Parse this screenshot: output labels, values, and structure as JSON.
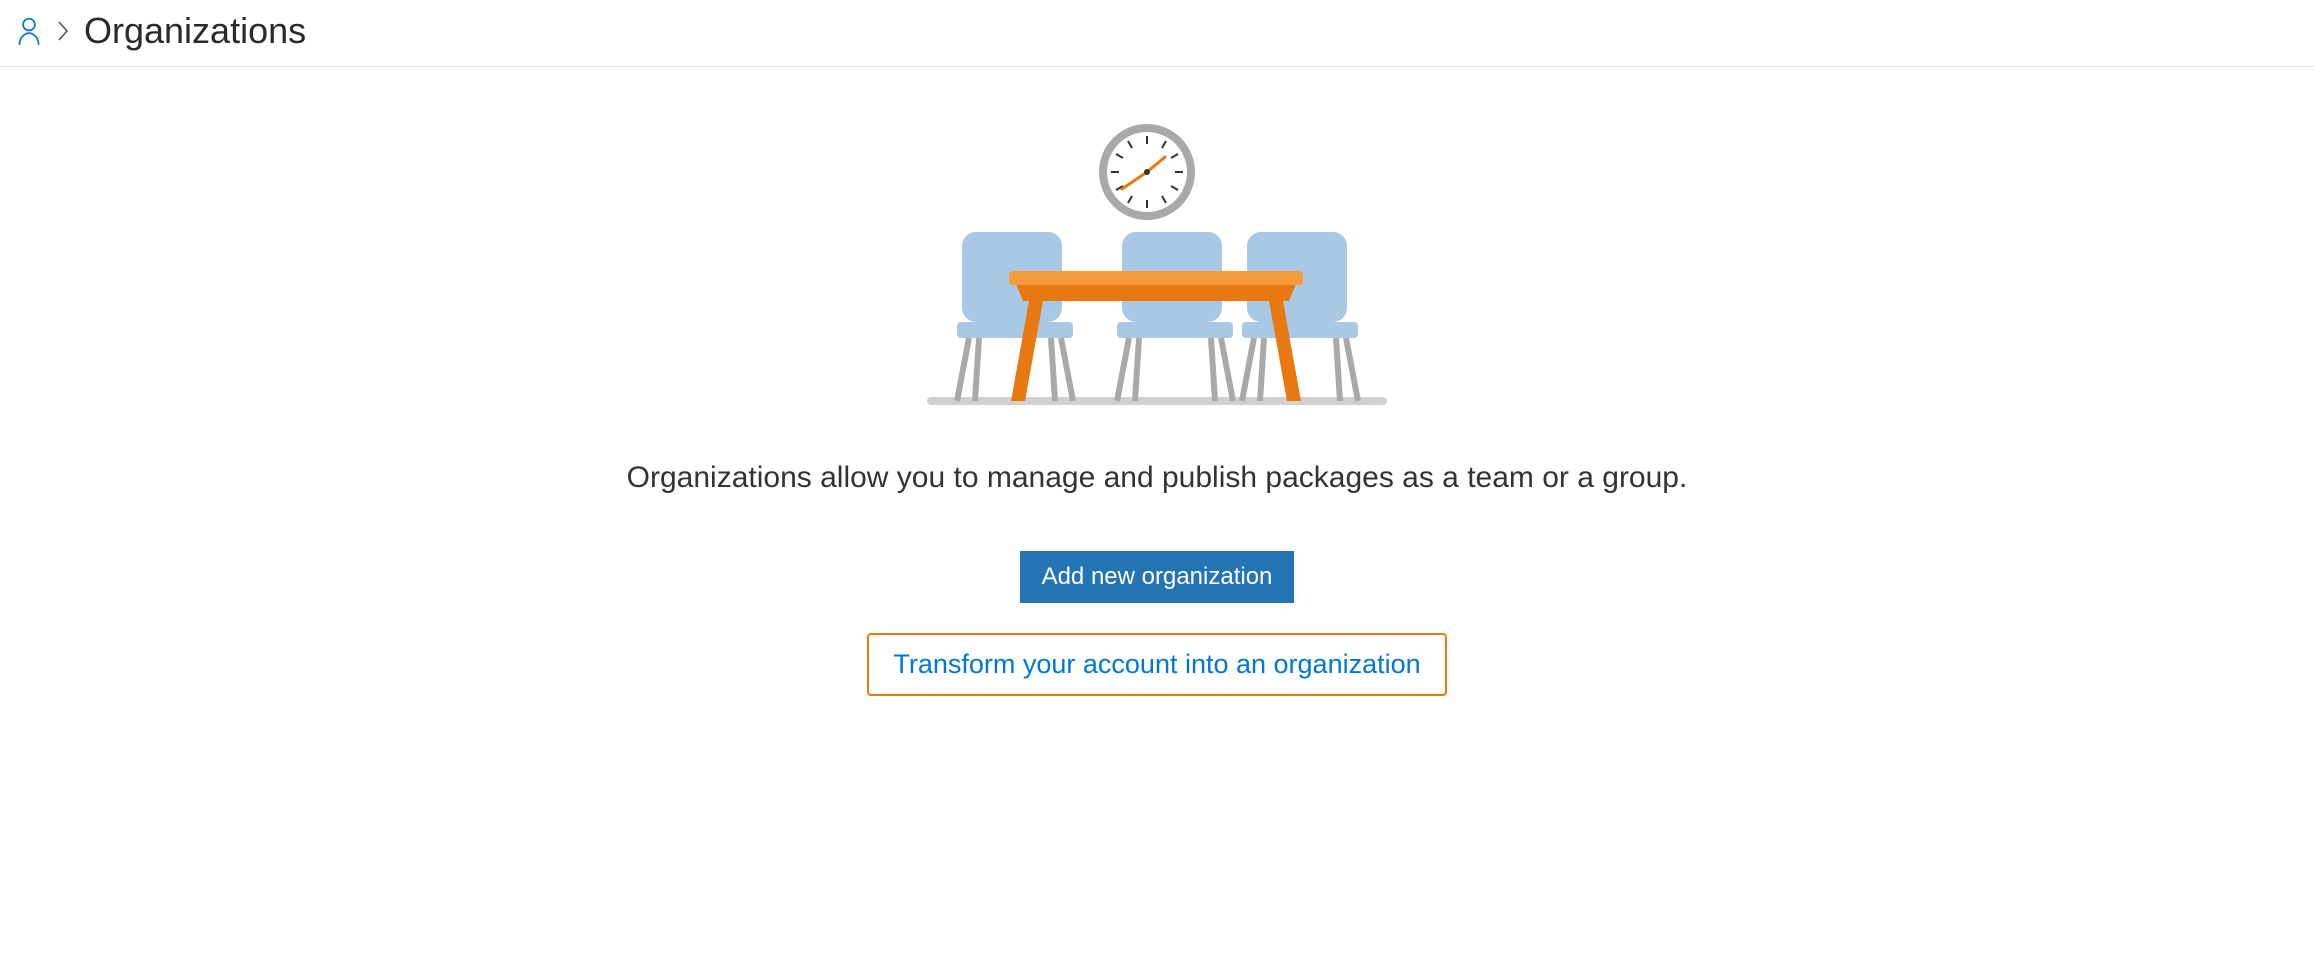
{
  "breadcrumb": {
    "title": "Organizations"
  },
  "main": {
    "tagline": "Organizations allow you to manage and publish packages as a team or a group.",
    "add_button_label": "Add new organization",
    "transform_button_label": "Transform your account into an organization"
  }
}
